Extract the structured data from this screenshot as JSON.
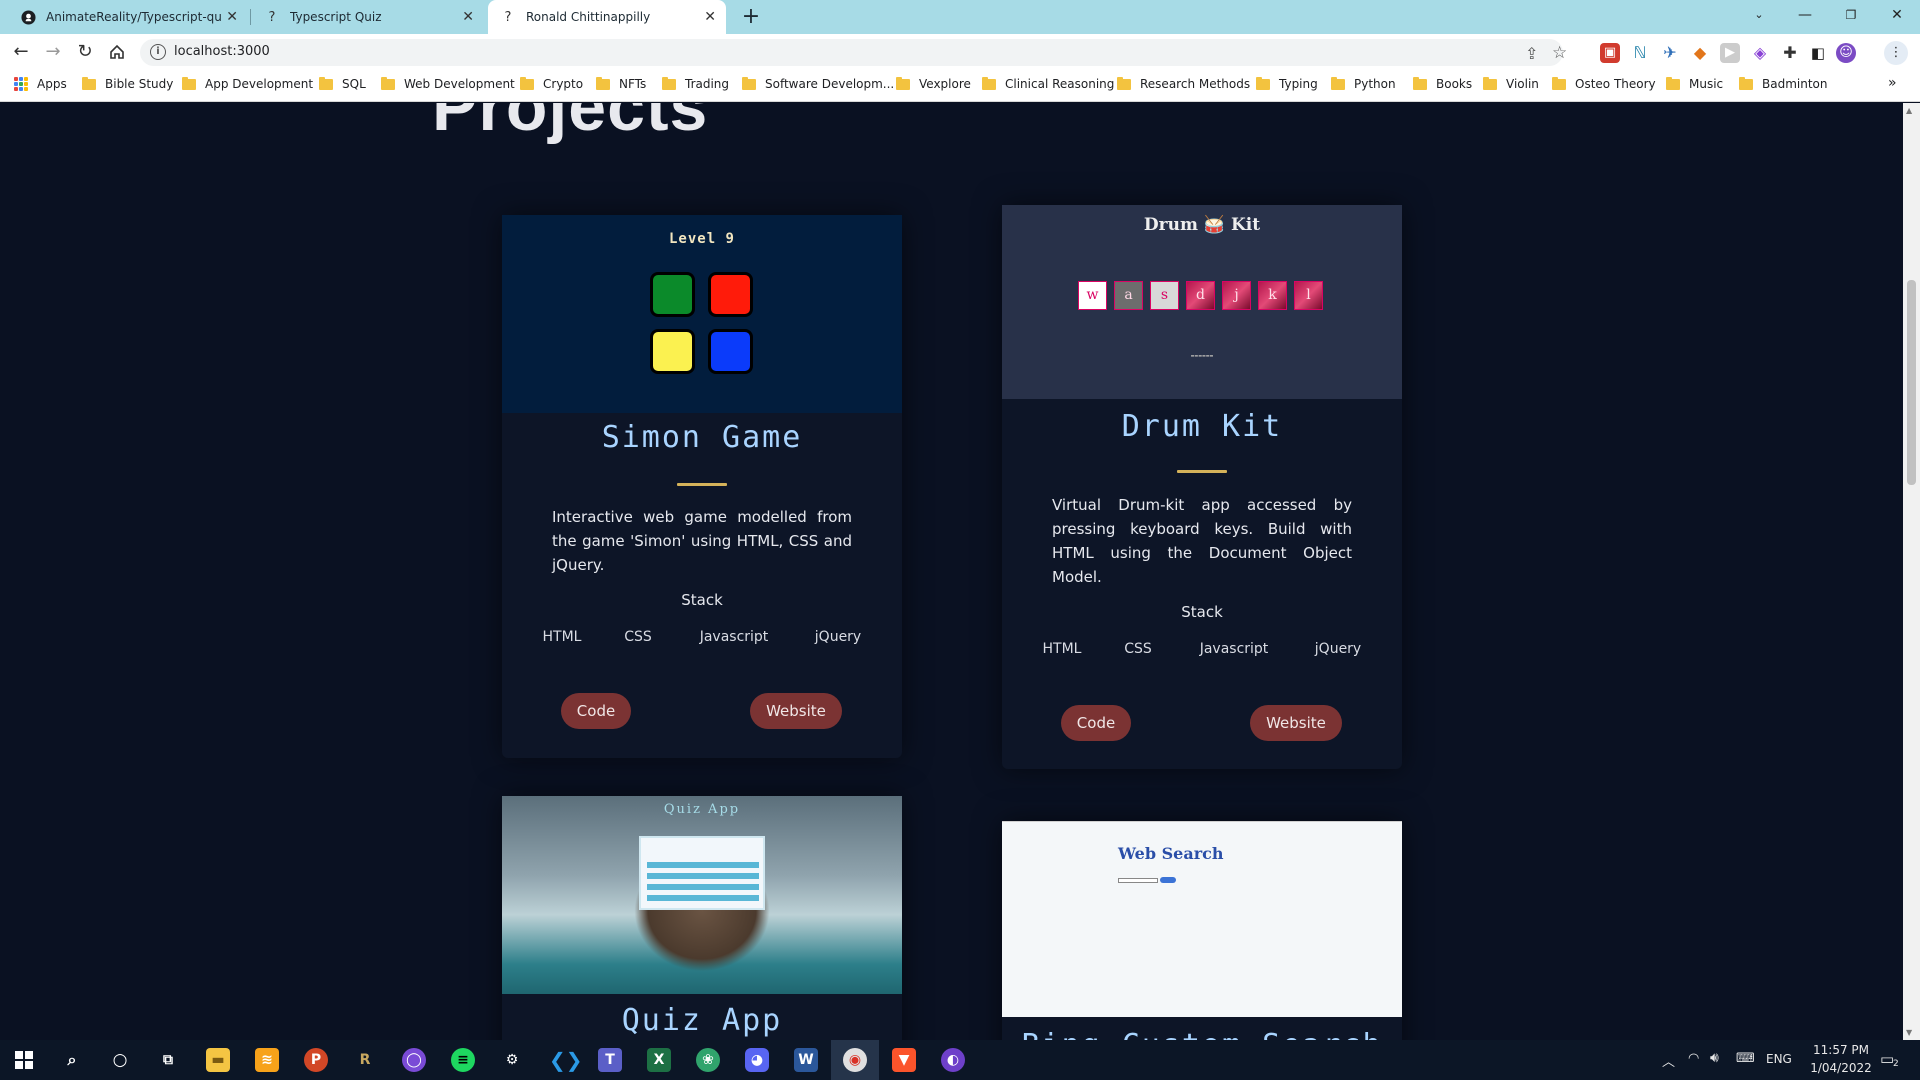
{
  "browser": {
    "tabs": [
      {
        "label": "AnimateReality/Typescript-quiz: A",
        "icon": "github-icon"
      },
      {
        "label": "Typescript Quiz",
        "icon": "question-icon"
      },
      {
        "label": "Ronald Chittinappilly",
        "icon": "question-icon",
        "active": true
      }
    ],
    "new_tab": "+",
    "url": "localhost:3000",
    "bookmarks": [
      "Apps",
      "Bible Study",
      "App Development",
      "SQL",
      "Web Development",
      "Crypto",
      "NFTs",
      "Trading",
      "Software Developm...",
      "Vexplore",
      "Clinical Reasoning",
      "Research Methods",
      "Typing",
      "Python",
      "Books",
      "Violin",
      "Osteo Theory",
      "Music",
      "Badminton"
    ],
    "more_bookmarks": "»"
  },
  "page": {
    "section_title": "Projects",
    "projects": [
      {
        "title": "Simon Game",
        "description": "Interactive web game modelled from the game 'Simon' using HTML, CSS and jQuery.",
        "stack_label": "Stack",
        "stack": [
          "HTML",
          "CSS",
          "Javascript",
          "jQuery"
        ],
        "code_label": "Code",
        "website_label": "Website",
        "preview": {
          "level_text": "Level 9"
        }
      },
      {
        "title": "Drum Kit",
        "description": "Virtual Drum-kit app accessed by pressing keyboard keys. Build with HTML using the Document Object Model.",
        "stack_label": "Stack",
        "stack": [
          "HTML",
          "CSS",
          "Javascript",
          "jQuery"
        ],
        "code_label": "Code",
        "website_label": "Website",
        "preview": {
          "title": "Drum 🥁 Kit",
          "keys": [
            "w",
            "a",
            "s",
            "d",
            "j",
            "k",
            "l"
          ]
        }
      },
      {
        "title": "Quiz App",
        "preview": {
          "title": "Quiz App"
        }
      },
      {
        "title": "Bing Custom Search",
        "preview": {
          "title": "Web Search"
        }
      }
    ]
  },
  "taskbar": {
    "language": "ENG",
    "time": "11:57 PM",
    "date": "1/04/2022",
    "notification_count": "2"
  },
  "colors": {
    "page_bg": "#0a1122",
    "card_title": "#a9d4ff",
    "accent_divider": "#d4b25a",
    "button_bg": "#7b3333",
    "tabbar_bg": "#a7dbe6"
  }
}
